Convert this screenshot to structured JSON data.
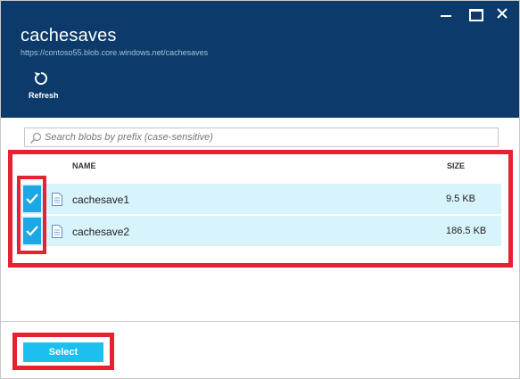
{
  "header": {
    "title": "cachesaves",
    "subtitle": "https://contoso55.blob.core.windows.net/cachesaves",
    "refresh_label": "Refresh"
  },
  "search": {
    "placeholder": "Search blobs by prefix (case-sensitive)"
  },
  "table": {
    "columns": {
      "name": "NAME",
      "size": "SIZE"
    },
    "rows": [
      {
        "name": "cachesave1",
        "size": "9.5 KB",
        "selected": true
      },
      {
        "name": "cachesave2",
        "size": "186.5 KB",
        "selected": true
      }
    ]
  },
  "footer": {
    "select_label": "Select"
  },
  "colors": {
    "header_bg": "#0b3a6b",
    "row_selected_bg": "#d7f3fb",
    "checkbox_bg": "#1aa9e6",
    "select_button_bg": "#1bc0f0",
    "highlight_red": "#e8202f"
  },
  "icons": {
    "minimize": "minimize-icon",
    "maximize": "maximize-icon",
    "close": "close-icon",
    "refresh": "refresh-icon",
    "search": "search-icon",
    "file": "file-icon",
    "check": "check-icon"
  }
}
